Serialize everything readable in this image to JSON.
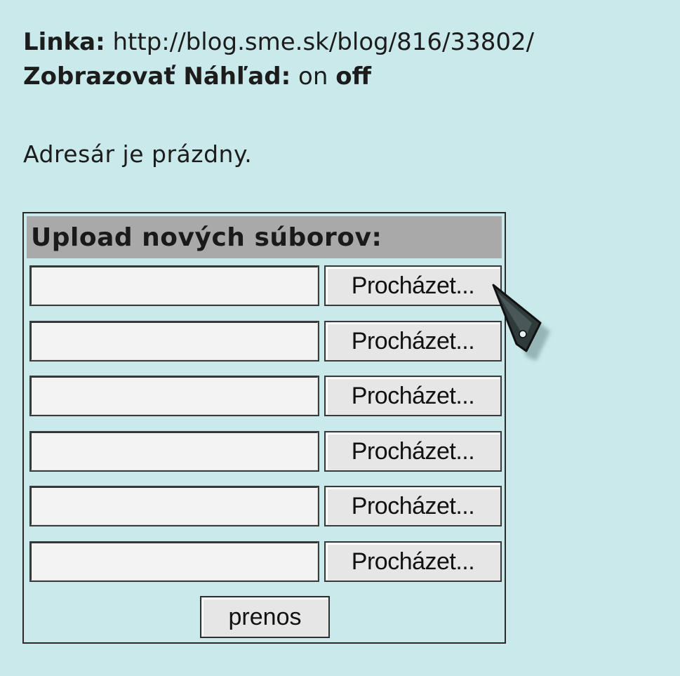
{
  "info": {
    "link_label": "Linka:",
    "link_value": "http://blog.sme.sk/blog/816/33802/",
    "preview_label": "Zobrazovať Náhľad:",
    "preview_on": "on",
    "preview_off": "off",
    "empty_message": "Adresár je prázdny."
  },
  "upload": {
    "title": "Upload nových súborov:",
    "browse_label": "Procházet...",
    "submit_label": "prenos",
    "row_count": 6
  },
  "cursor": {
    "icon": "mouse-pointer-icon"
  }
}
